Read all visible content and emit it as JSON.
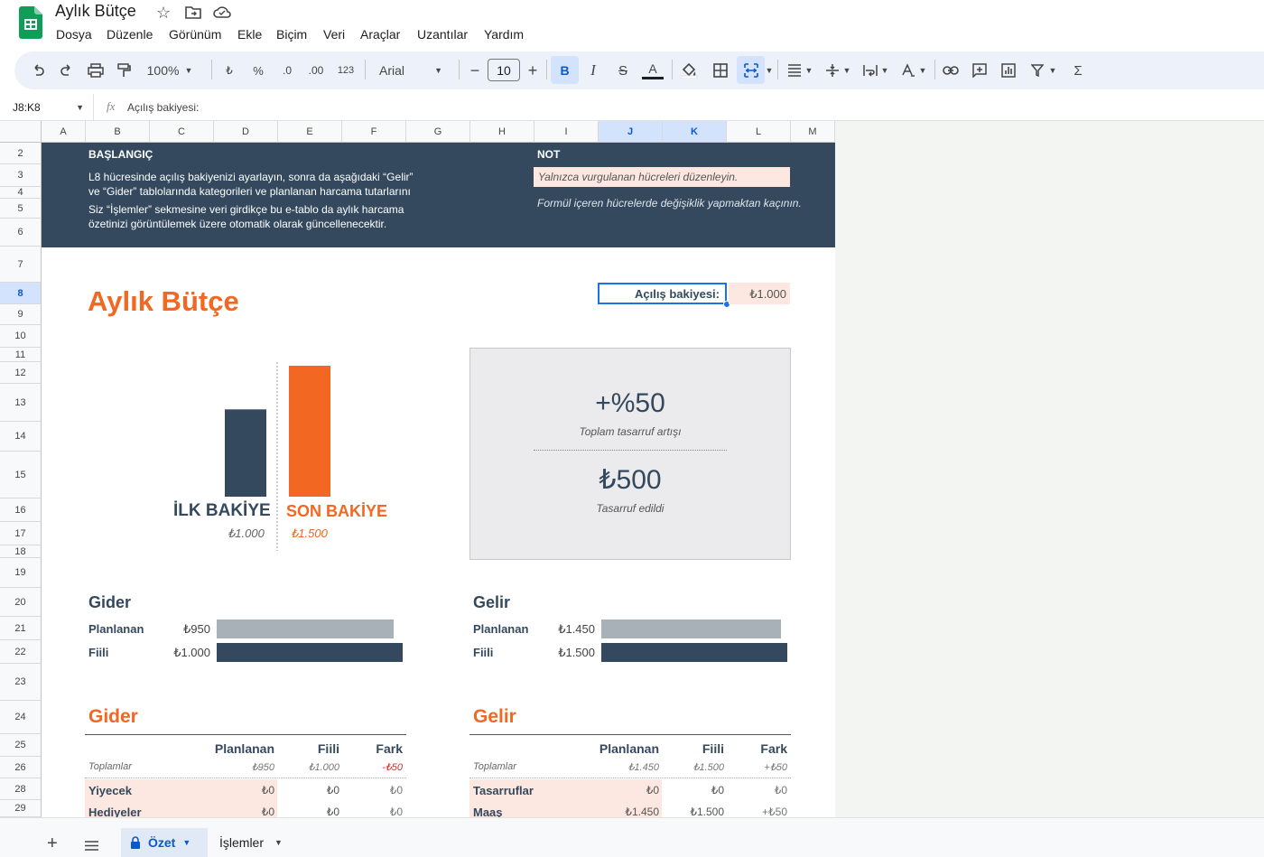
{
  "doc_title": "Aylık Bütçe",
  "menu": [
    "Dosya",
    "Düzenle",
    "Görünüm",
    "Ekle",
    "Biçim",
    "Veri",
    "Araçlar",
    "Uzantılar",
    "Yardım"
  ],
  "toolbar": {
    "zoom": "100%",
    "currency": "₺",
    "percent": "%",
    "dec_less": ".0",
    "dec_more": ".00",
    "format_123": "123",
    "font": "Arial",
    "font_size": "10",
    "bold": "B",
    "italic": "I",
    "strike": "S",
    "text_color": "A",
    "minus": "−",
    "plus": "+",
    "sigma": "Σ"
  },
  "formula_bar": {
    "name_box": "J8:K8",
    "fx": "fx",
    "content": "Açılış bakiyesi:"
  },
  "columns": [
    "A",
    "B",
    "C",
    "D",
    "E",
    "F",
    "G",
    "H",
    "I",
    "J",
    "K",
    "L",
    "M"
  ],
  "rows": [
    "2",
    "3",
    "4",
    "5",
    "6",
    "7",
    "8",
    "9",
    "10",
    "11",
    "12",
    "13",
    "14",
    "15",
    "16",
    "17",
    "18",
    "19",
    "20",
    "21",
    "22",
    "23",
    "24",
    "25",
    "26",
    "28",
    "29"
  ],
  "banner": {
    "start_title": "BAŞLANGIÇ",
    "start_l1": "L8 hücresinde açılış bakiyenizi ayarlayın, sonra da aşağıdaki “Gelir”",
    "start_l2": "ve “Gider” tablolarında kategorileri ve planlanan harcama tutarlarını",
    "start_l3": "Siz “İşlemler” sekmesine veri girdikçe bu e-tablo da aylık harcama",
    "start_l4": "özetinizi görüntülemek üzere otomatik olarak güncellenecektir.",
    "note_title": "NOT",
    "note_box": "Yalnızca vurgulanan hücreleri düzenleyin.",
    "note_text": "Formül içeren hücrelerde değişiklik yapmaktan kaçının."
  },
  "budget_title": "Aylık Bütçe",
  "opening": {
    "label": "Açılış bakiyesi:",
    "value": "₺1.000"
  },
  "balance_chart": {
    "left_label": "İLK BAKİYE",
    "left_value": "₺1.000",
    "right_label": "SON BAKİYE",
    "right_value": "₺1.500",
    "colors": {
      "left": "#34495e",
      "right": "#f26722"
    }
  },
  "chart_data": {
    "type": "bar",
    "categories": [
      "İLK BAKİYE",
      "SON BAKİYE"
    ],
    "values": [
      1000,
      1500
    ]
  },
  "savings": {
    "pct": "+%50",
    "pct_label": "Toplam tasarruf artışı",
    "amount": "₺500",
    "amount_label": "Tasarruf edildi"
  },
  "expense_summary": {
    "title": "Gider",
    "planned_label": "Planlanan",
    "planned_value": "₺950",
    "actual_label": "Fiili",
    "actual_value": "₺1.000",
    "planned": 950,
    "actual": 1000
  },
  "income_summary": {
    "title": "Gelir",
    "planned_label": "Planlanan",
    "planned_value": "₺1.450",
    "actual_label": "Fiili",
    "actual_value": "₺1.500",
    "planned": 1450,
    "actual": 1500
  },
  "expense_table": {
    "title": "Gider",
    "headers": [
      "Planlanan",
      "Fiili",
      "Fark"
    ],
    "totals_label": "Toplamlar",
    "totals": [
      "₺950",
      "₺1.000",
      "-₺50"
    ],
    "rows": [
      {
        "name": "Yiyecek",
        "vals": [
          "₺0",
          "₺0",
          "₺0"
        ]
      },
      {
        "name": "Hediyeler",
        "vals": [
          "₺0",
          "₺0",
          "₺0"
        ]
      }
    ]
  },
  "income_table": {
    "title": "Gelir",
    "headers": [
      "Planlanan",
      "Fiili",
      "Fark"
    ],
    "totals_label": "Toplamlar",
    "totals": [
      "₺1.450",
      "₺1.500",
      "+₺50"
    ],
    "rows": [
      {
        "name": "Tasarruflar",
        "vals": [
          "₺0",
          "₺0",
          "₺0"
        ]
      },
      {
        "name": "Maaş",
        "vals": [
          "₺1.450",
          "₺1.500",
          "+₺50"
        ]
      }
    ]
  },
  "tabs": [
    {
      "label": "Özet"
    },
    {
      "label": "İşlemler"
    }
  ]
}
